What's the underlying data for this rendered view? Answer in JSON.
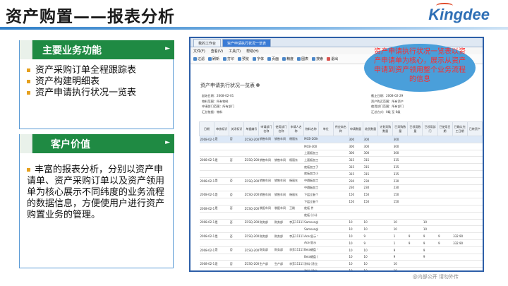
{
  "header": {
    "title": "资产购置——报表分析",
    "logo": "Kingdee"
  },
  "panels": {
    "main_functions": {
      "heading": "主要业务功能",
      "items": [
        "资产采购订单全程跟踪表",
        "资产构建明细表",
        "资产申请执行状况一览表"
      ]
    },
    "customer_value": {
      "heading": "客户价值",
      "text": "丰富的报表分析，分别以资产申请单、资产采购订单以及资产领用单为核心展示不同纬度的业务流程的数据信息，方便使用户进行资产购置业务的管理。"
    }
  },
  "screenshot": {
    "tabs": [
      "我的工作台",
      "资产申请执行状况一览表"
    ],
    "menu": [
      "文件(F)",
      "查看(V)",
      "工具(T)",
      "帮助(H)"
    ],
    "toolbar": [
      "过滤",
      "刷新",
      "打印",
      "预览",
      "字体",
      "页面",
      "精度",
      "图表",
      "搜索",
      "退出"
    ],
    "report_title": "资产申请执行状况一览表",
    "info_left": [
      "起始日期：2008-02-01",
      "物料范围：所有物料",
      "申请部门范围：所有部门",
      "汇总依据：物料"
    ],
    "info_right": [
      "截止日期：2008-02-29",
      "资产购买范围：所有资产",
      "使用部门范围：所有部门",
      "汇总方式：0级 至 0级"
    ],
    "columns": [
      "日期",
      "审核标识",
      "关闭标识",
      "单据编号",
      "申请部门名称",
      "使用部门名称",
      "申请人名称",
      "物料名称",
      "单位",
      "供应商名称",
      "申请数量",
      "收货数量",
      "计划采购数量",
      "已采购数量",
      "已领用数量",
      "已领用部门",
      "已使用日期",
      "已确认完工日期",
      "已转资产"
    ],
    "rows": [
      [
        "2008-02-1",
        "是",
        "否",
        "ZCSQ-2008",
        "销售车间",
        "销售车间",
        "杨丽东",
        "MCB-200电子",
        "",
        "",
        "300",
        "300",
        "",
        "300",
        "",
        "",
        "",
        "",
        ""
      ],
      [
        "",
        "",
        "",
        "",
        "",
        "",
        "",
        "MCB-300",
        "",
        "",
        "300",
        "300",
        "",
        "300",
        "",
        "",
        "",
        "",
        ""
      ],
      [
        "",
        "",
        "",
        "",
        "",
        "",
        "",
        "上面板加工子",
        "",
        "",
        "300",
        "300",
        "",
        "300",
        "",
        "",
        "",
        "",
        ""
      ],
      [
        "2008-02-1",
        "是",
        "否",
        "ZCSQ-2008",
        "销售车间",
        "销售车间",
        "杨丽东",
        "上面板加工子",
        "",
        "",
        "315",
        "315",
        "",
        "315",
        "",
        "",
        "",
        "",
        ""
      ],
      [
        "",
        "",
        "",
        "",
        "",
        "",
        "",
        "底板加工子",
        "",
        "",
        "315",
        "315",
        "",
        "315",
        "",
        "",
        "",
        "",
        ""
      ],
      [
        "",
        "",
        "",
        "",
        "",
        "",
        "",
        "底板加工小",
        "",
        "",
        "315",
        "315",
        "",
        "315",
        "",
        "",
        "",
        "",
        ""
      ],
      [
        "2008-02-1",
        "是",
        "否",
        "ZCSQ-2008",
        "销售车间",
        "销售车间",
        "杨丽东",
        "中隔板加工子",
        "",
        "",
        "230",
        "230",
        "",
        "230",
        "",
        "",
        "",
        "",
        ""
      ],
      [
        "",
        "",
        "",
        "",
        "",
        "",
        "",
        "中隔板加工子",
        "",
        "",
        "230",
        "230",
        "",
        "230",
        "",
        "",
        "",
        "",
        ""
      ],
      [
        "2008-02-1",
        "是",
        "否",
        "ZCSQ-2008",
        "销售车间",
        "销售车间",
        "杨丽东",
        "下层立板个",
        "",
        "",
        "150",
        "150",
        "",
        "150",
        "",
        "",
        "",
        "",
        ""
      ],
      [
        "",
        "",
        "",
        "",
        "",
        "",
        "",
        "下层立板个",
        "",
        "",
        "150",
        "150",
        "",
        "150",
        "",
        "",
        "",
        "",
        ""
      ],
      [
        "2008-02-1",
        "是",
        "否",
        "ZCSQ-2008",
        "装配车间",
        "装配车间",
        "王刚",
        "舵板 件",
        "",
        "",
        "",
        "",
        "",
        "",
        "",
        "",
        "",
        "",
        ""
      ],
      [
        "",
        "",
        "",
        "",
        "",
        "",
        "",
        "舵板 (小计",
        "",
        "",
        "",
        "",
        "",
        "",
        "",
        "",
        "",
        "",
        ""
      ],
      [
        "2008-02-1",
        "是",
        "否",
        "ZCSQ-2008",
        "财务部",
        "财务部",
        "李芳11111",
        "Samsung件",
        "",
        "",
        "10",
        "10",
        "",
        "10",
        "",
        "10",
        "",
        "",
        ""
      ],
      [
        "",
        "",
        "",
        "",
        "",
        "",
        "",
        "Samsung(",
        "",
        "",
        "10",
        "10",
        "",
        "10",
        "",
        "10",
        "",
        "",
        ""
      ],
      [
        "2008-02-1",
        "是",
        "否",
        "ZCSQ-2008",
        "财务部",
        "财务部",
        "李芳11111",
        "Acer显示 个",
        "",
        "",
        "10",
        "9",
        "",
        "1",
        "9",
        "9",
        "9",
        "332.90",
        ""
      ],
      [
        "",
        "",
        "",
        "",
        "",
        "",
        "",
        "Acer显示",
        "",
        "",
        "10",
        "9",
        "",
        "1",
        "9",
        "9",
        "9",
        "332.90",
        ""
      ],
      [
        "2008-02-1",
        "是",
        "否",
        "ZCSQ-2008",
        "财务部",
        "财务部",
        "李芳11111",
        "Beia键盘 个",
        "",
        "",
        "10",
        "10",
        "",
        "9",
        "",
        "9",
        "",
        "",
        ""
      ],
      [
        "",
        "",
        "",
        "",
        "",
        "",
        "",
        "Beia键盘 (",
        "",
        "",
        "10",
        "10",
        "",
        "9",
        "",
        "9",
        "",
        "",
        ""
      ],
      [
        "2008-02-1",
        "是",
        "否",
        "ZCSQ-2008",
        "生产部",
        "生产部",
        "李芳11111",
        "涂料 (涂立公斤",
        "",
        "",
        "10",
        "10",
        "",
        "10",
        "",
        "",
        "",
        "",
        ""
      ],
      [
        "",
        "",
        "",
        "",
        "",
        "",
        "",
        "涂料 (涂立",
        "",
        "",
        "10",
        "10",
        "",
        "10",
        "",
        "",
        "",
        "",
        ""
      ]
    ]
  },
  "callout": {
    "text": "资产申请执行状况一览表以资产申请单为核心，展示从资产申请到资产领用整个业务流程的信息"
  },
  "footer": "@内部公开 请勿外传",
  "colors": {
    "panel_green": "#1f8a43",
    "border_blue": "#5b9bd5",
    "bullet_orange": "#e6a01e",
    "callout_blue": "#4a9fda",
    "callout_text_red": "#ff2a2a"
  }
}
